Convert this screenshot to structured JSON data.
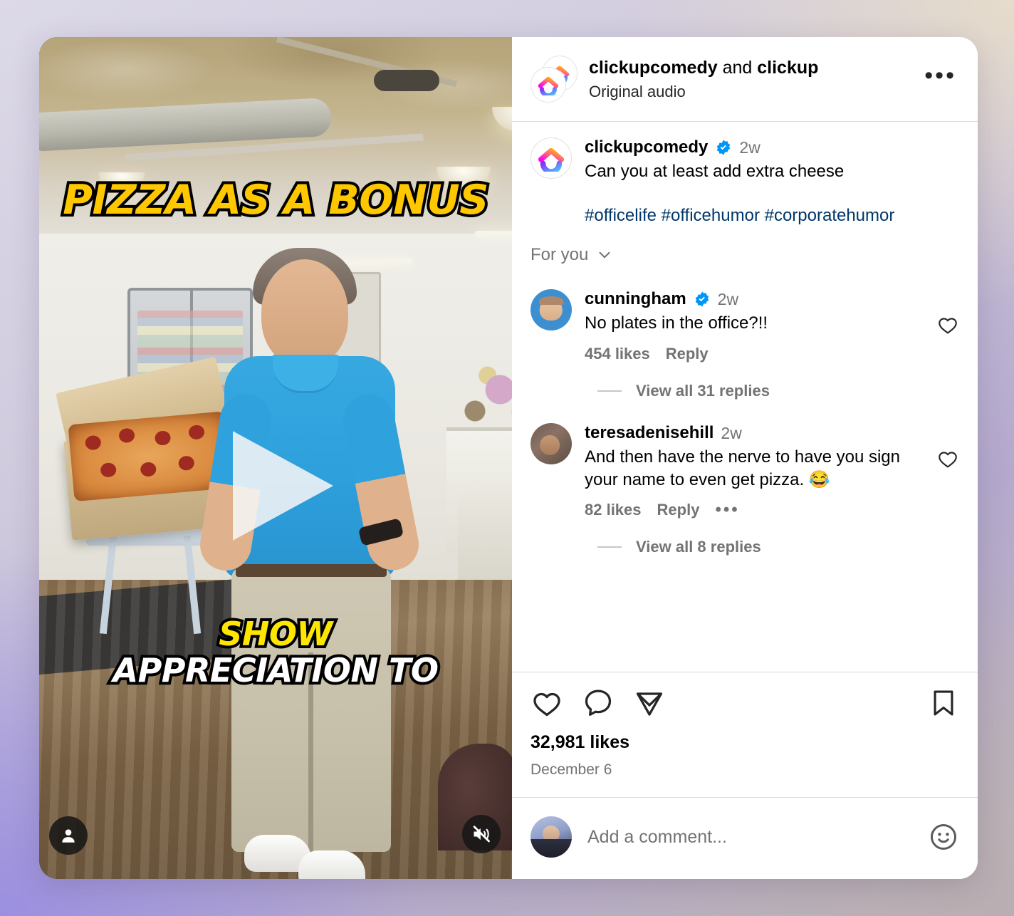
{
  "header": {
    "audio_title_user1": "clickupcomedy",
    "audio_title_conj": " and ",
    "audio_title_user2": "clickup",
    "audio_subtitle": "Original audio",
    "more_options": "•••"
  },
  "caption": {
    "username": "clickupcomedy",
    "verified": true,
    "time": "2w",
    "text": "Can you at least add extra cheese",
    "hashtags": "#officelife #officehumor #corporatehumor"
  },
  "comments_filter": {
    "label": "For you",
    "icon": "chevron-down-icon"
  },
  "comments": [
    {
      "username": "cunningham",
      "verified": true,
      "time": "2w",
      "text": "No plates in the office?!!",
      "likes": "454 likes",
      "reply": "Reply",
      "has_more_dots": false,
      "replies_label": "View all 31 replies"
    },
    {
      "username": "teresadenisehill",
      "verified": false,
      "time": "2w",
      "text": "And then have the nerve to have you sign your name to even get pizza. 😂",
      "likes": "82 likes",
      "reply": "Reply",
      "has_more_dots": true,
      "more_dots": "•••",
      "replies_label": "View all 8 replies"
    }
  ],
  "actions": {
    "like_icon": "heart-icon",
    "comment_icon": "comment-bubble-icon",
    "share_icon": "share-paperplane-icon",
    "save_icon": "bookmark-icon",
    "likes_count": "32,981 likes",
    "date": "December 6"
  },
  "add_comment": {
    "placeholder": "Add a comment...",
    "value": "",
    "emoji_icon": "emoji-smiley-icon"
  },
  "video": {
    "caption_top": "PIZZA AS A BONUS",
    "caption_bottom_line1": "SHOW",
    "caption_bottom_line2": "APPRECIATION TO",
    "play_icon": "play-triangle-icon",
    "tag_people_icon": "person-icon",
    "mute_icon": "speaker-muted-icon"
  },
  "colors": {
    "verified_blue": "#0095F6",
    "link_blue": "#00376b",
    "muted_gray": "#737373",
    "caption_yellow": "#FFC700",
    "caption_white": "#FFFFFF",
    "divider": "#dbdbdb"
  }
}
